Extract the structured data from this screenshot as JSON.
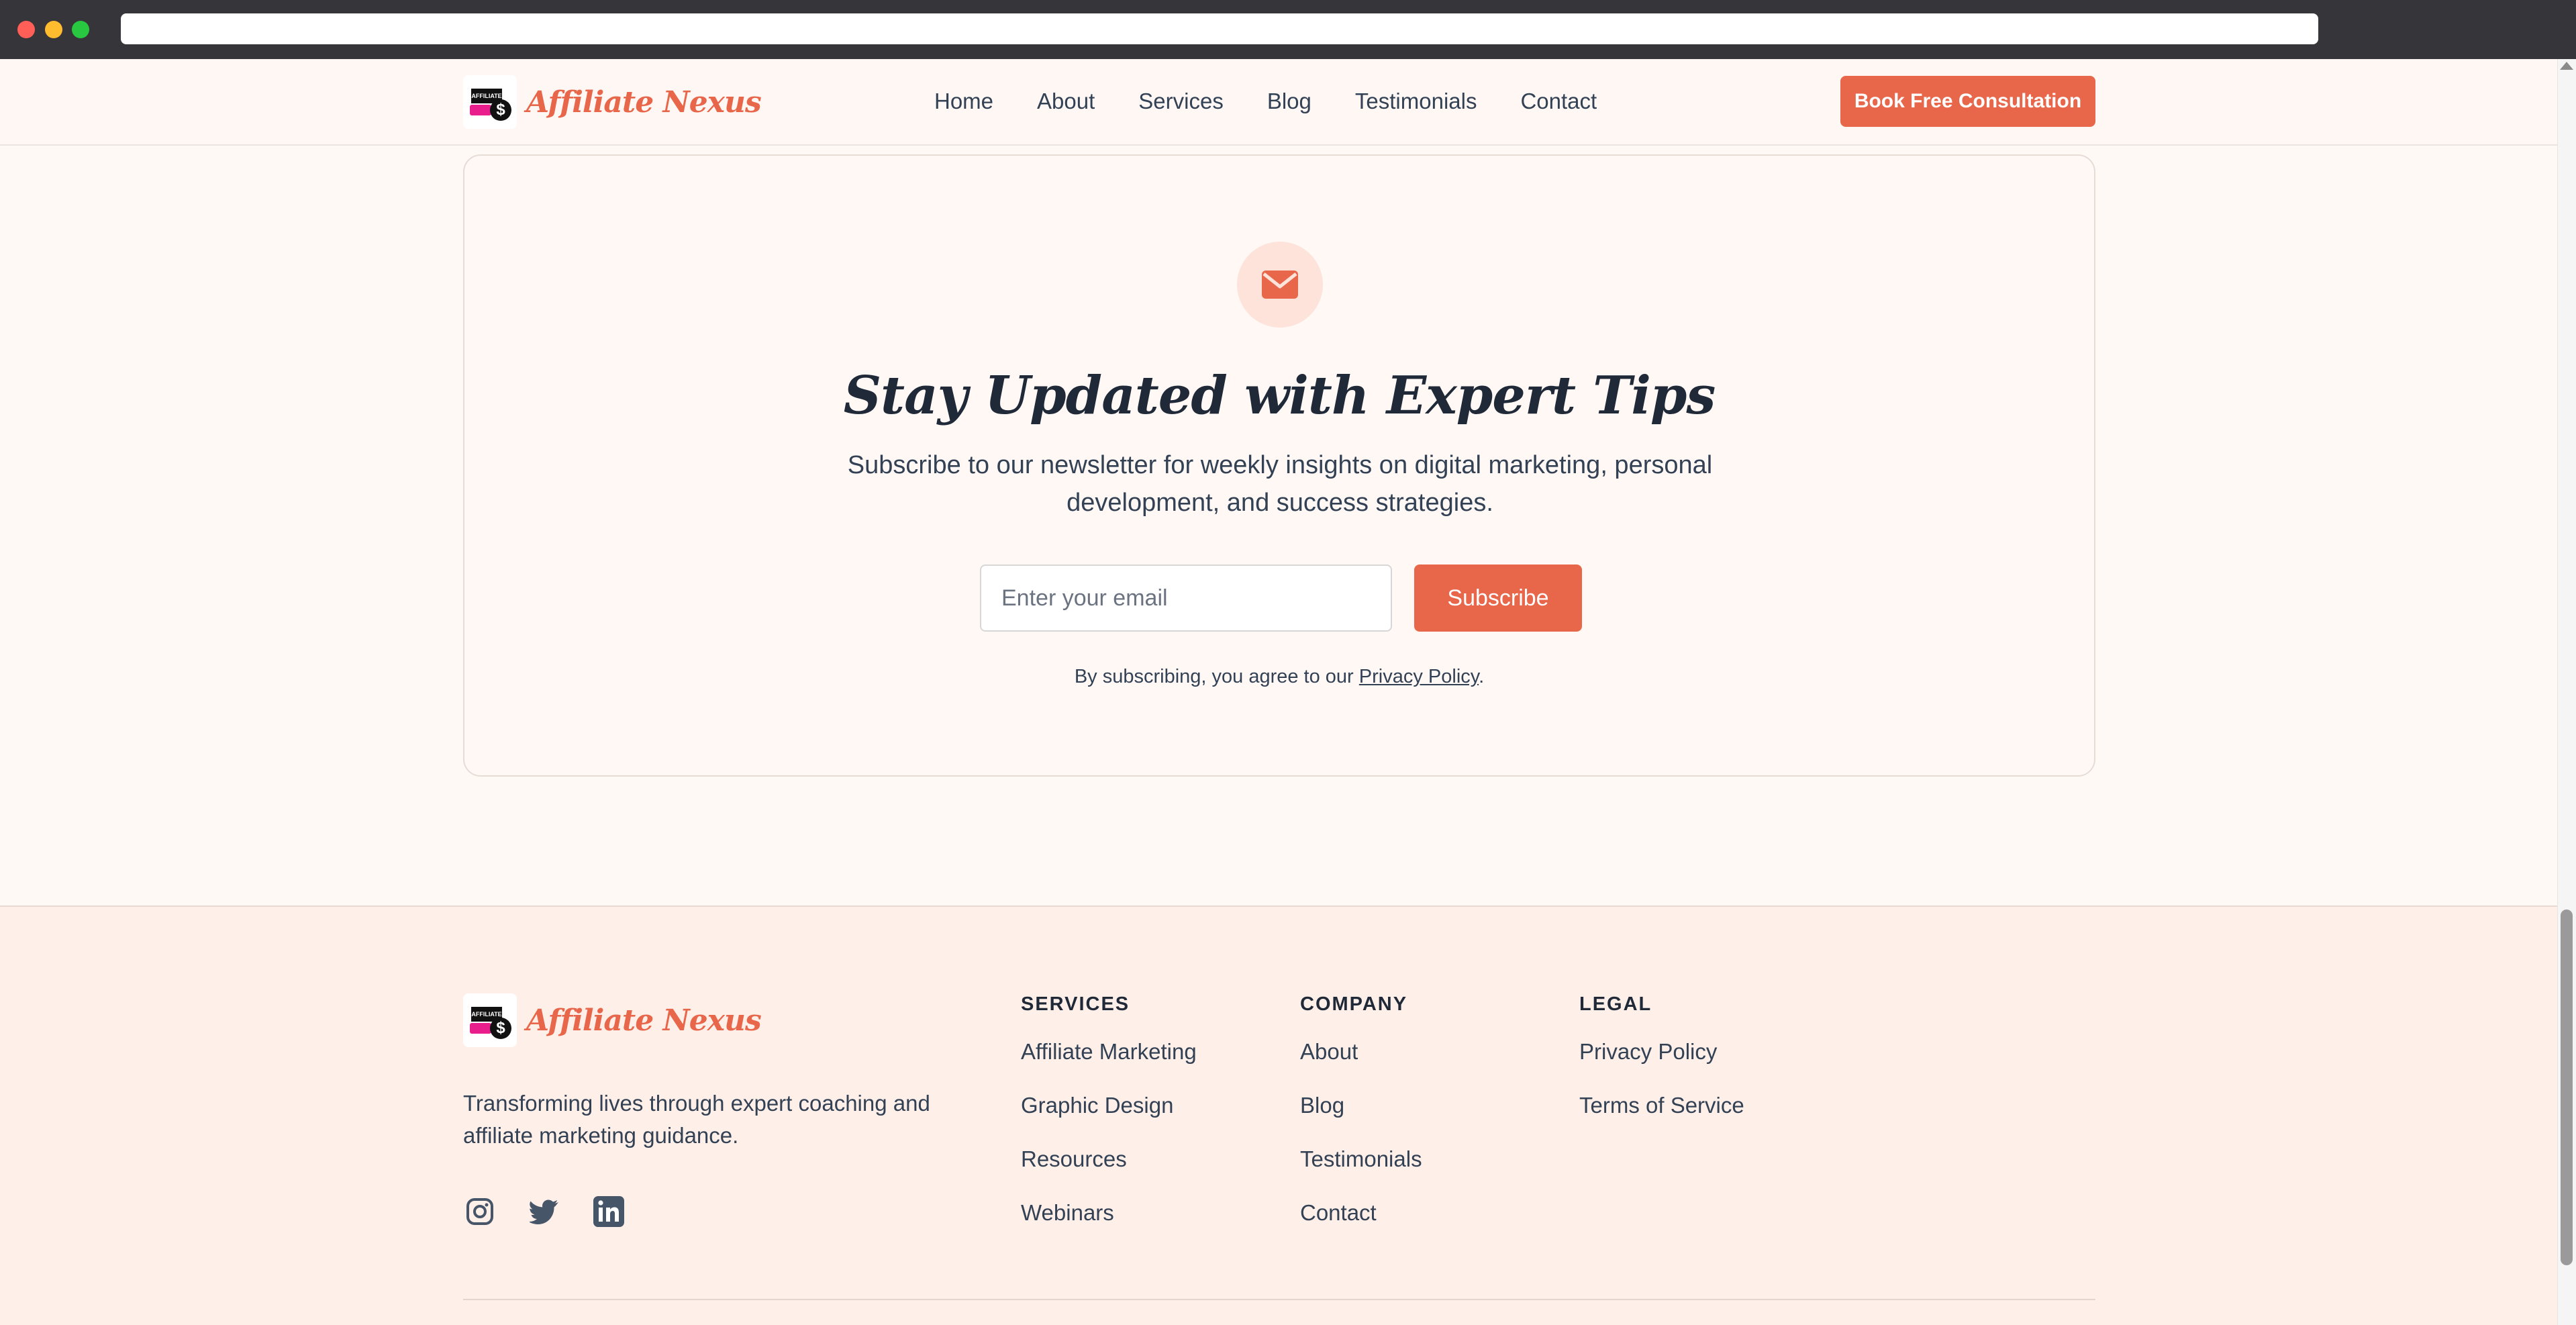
{
  "brand": {
    "name": "Affiliate Nexus",
    "logo_badge": "AFFILIATE",
    "logo_coin": "$"
  },
  "nav": {
    "links": [
      "Home",
      "About",
      "Services",
      "Blog",
      "Testimonials",
      "Contact"
    ],
    "cta": "Book Free Consultation"
  },
  "newsletter": {
    "title": "Stay Updated with Expert Tips",
    "subtitle": "Subscribe to our newsletter for weekly insights on digital marketing, personal development, and success strategies.",
    "email_placeholder": "Enter your email",
    "subscribe_label": "Subscribe",
    "disclaimer_prefix": "By subscribing, you agree to our ",
    "disclaimer_link": "Privacy Policy",
    "disclaimer_suffix": "."
  },
  "footer": {
    "description": "Transforming lives through expert coaching and affiliate marketing guidance.",
    "socials": [
      "instagram-icon",
      "twitter-icon",
      "linkedin-icon"
    ],
    "columns": [
      {
        "heading": "SERVICES",
        "links": [
          "Affiliate Marketing",
          "Graphic Design",
          "Resources",
          "Webinars"
        ]
      },
      {
        "heading": "COMPANY",
        "links": [
          "About",
          "Blog",
          "Testimonials",
          "Contact"
        ]
      },
      {
        "heading": "LEGAL",
        "links": [
          "Privacy Policy",
          "Terms of Service"
        ]
      }
    ]
  },
  "colors": {
    "accent": "#e8674b",
    "text": "#334155",
    "heading": "#1f2937",
    "footer_bg": "#ffefe9"
  }
}
